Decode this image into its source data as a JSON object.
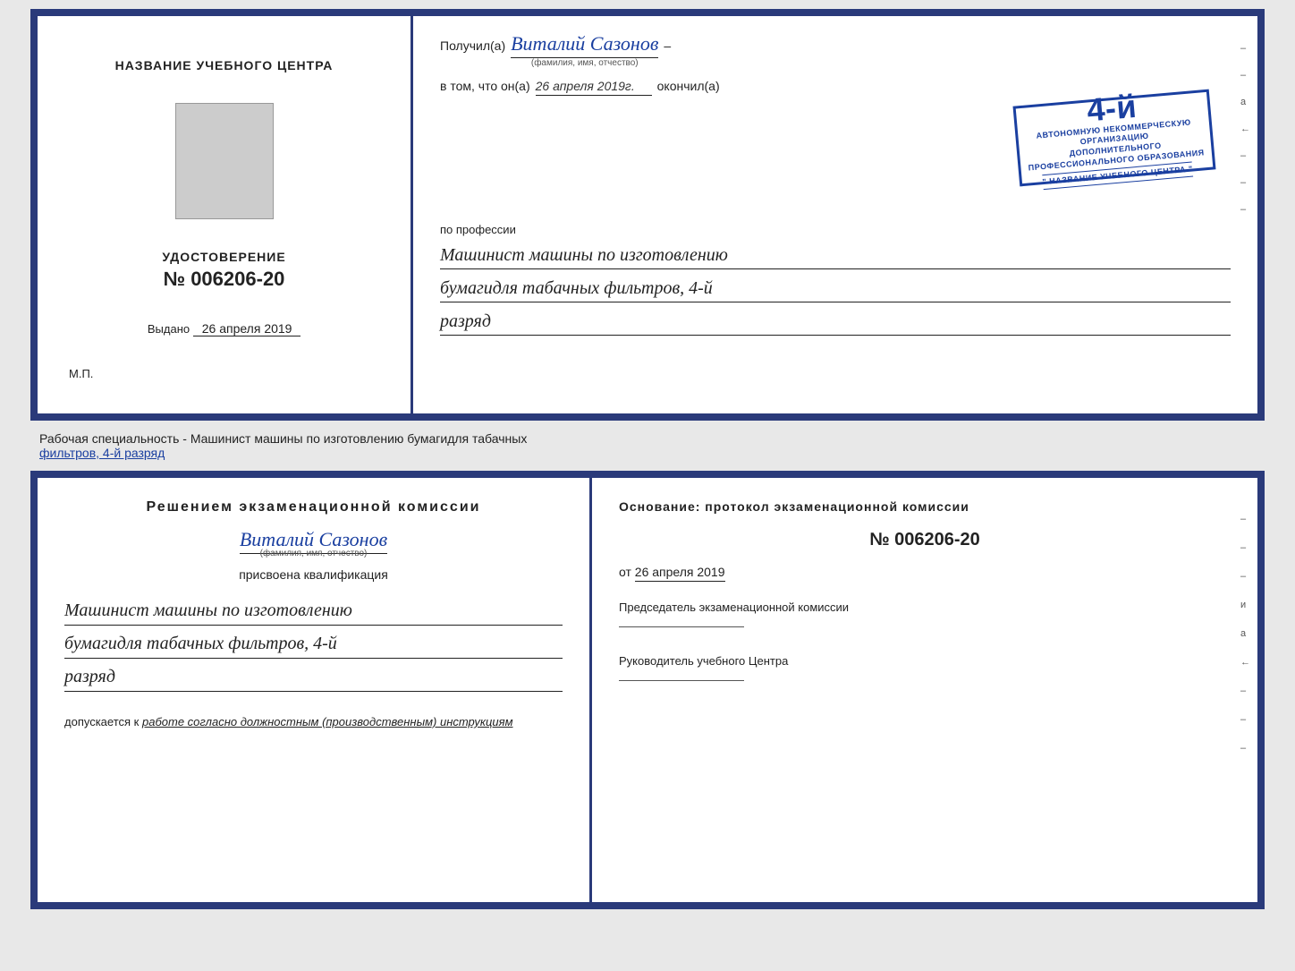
{
  "top": {
    "left": {
      "title": "НАЗВАНИЕ УЧЕБНОГО ЦЕНТРА",
      "udostoverenie_label": "УДОСТОВЕРЕНИЕ",
      "number": "№ 006206-20",
      "vydano_label": "Выдано",
      "vydano_date": "26 апреля 2019",
      "mp": "М.П."
    },
    "right": {
      "poluchil": "Получил(а)",
      "recipient_name": "Виталий Сазонов",
      "fio_hint": "(фамилия, имя, отчество)",
      "dash": "–",
      "vtom_prefix": "в том, что он(а)",
      "vtom_date": "26 апреля 2019г.",
      "okonchil": "окончил(а)",
      "stamp_big": "4-й",
      "stamp_line1": "АВТОНОМНУЮ НЕКОММЕРЧЕСКУЮ ОРГАНИЗАЦИЮ",
      "stamp_line2": "ДОПОЛНИТЕЛЬНОГО ПРОФЕССИОНАЛЬНОГО ОБРАЗОВАНИЯ",
      "stamp_center": "\" НАЗВАНИЕ УЧЕБНОГО ЦЕНТРА \"",
      "po_professii": "по профессии",
      "profession1": "Машинист машины по изготовлению",
      "profession2": "бумагидля табачных фильтров, 4-й",
      "profession3": "разряд"
    }
  },
  "middle": {
    "label": "Рабочая специальность - Машинист машины по изготовлению бумагидля табачных",
    "label2": "фильтров, 4-й разряд"
  },
  "bottom": {
    "left": {
      "decision": "Решением экзаменационной комиссии",
      "person_name": "Виталий Сазонов",
      "fio_hint": "(фамилия, имя, отчество)",
      "prisvoena": "присвоена квалификация",
      "qualification1": "Машинист машины по изготовлению",
      "qualification2": "бумагидля табачных фильтров, 4-й",
      "qualification3": "разряд",
      "dopuskaetsya_label": "допускается к",
      "dopuskaetsya_text": "работе согласно должностным (производственным) инструкциям"
    },
    "right": {
      "osnovaniye": "Основание: протокол экзаменационной комиссии",
      "protocol_number": "№ 006206-20",
      "ot_prefix": "от",
      "ot_date": "26 апреля 2019",
      "chairman_label": "Председатель экзаменационной комиссии",
      "rukovoditel_label": "Руководитель учебного Центра"
    }
  },
  "side_marks": [
    "-",
    "–",
    "-",
    "а",
    "←",
    "-",
    "-",
    "-"
  ]
}
